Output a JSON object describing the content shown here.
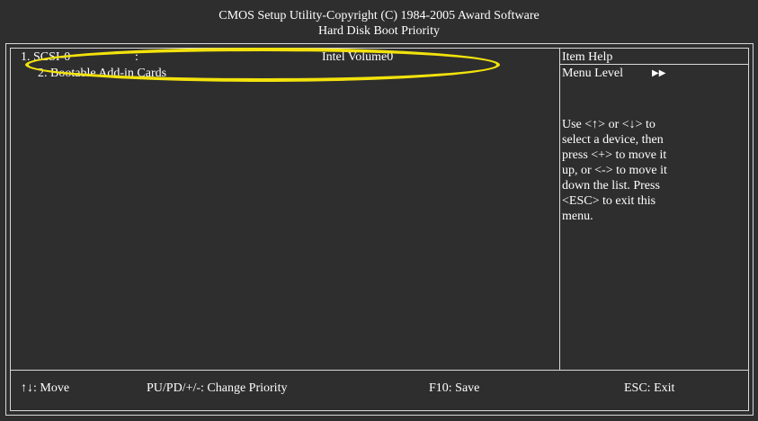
{
  "header": {
    "title": "CMOS Setup Utility-Copyright (C) 1984-2005 Award Software",
    "subtitle": "Hard Disk Boot Priority"
  },
  "boot_list": {
    "items": [
      {
        "label": "1. SCSI-0",
        "separator": ":",
        "value": "Intel Volume0"
      },
      {
        "label": "2. Bootable Add-in Cards"
      }
    ]
  },
  "help_panel": {
    "title": "Item Help",
    "menu_level_label": "Menu Level",
    "menu_level_indicator": "▶▶",
    "lines": [
      "Use <↑> or <↓> to",
      "select a device, then",
      "press <+> to move it",
      "up, or <-> to move it",
      "down the list. Press",
      "<ESC> to exit this",
      "menu."
    ]
  },
  "footer": {
    "move": "↑↓: Move",
    "change_priority": "PU/PD/+/-: Change Priority",
    "save": "F10: Save",
    "exit": "ESC: Exit"
  },
  "colors": {
    "background": "#2e2e2e",
    "text": "#ffffff",
    "highlight_ring": "#f2e20c"
  }
}
